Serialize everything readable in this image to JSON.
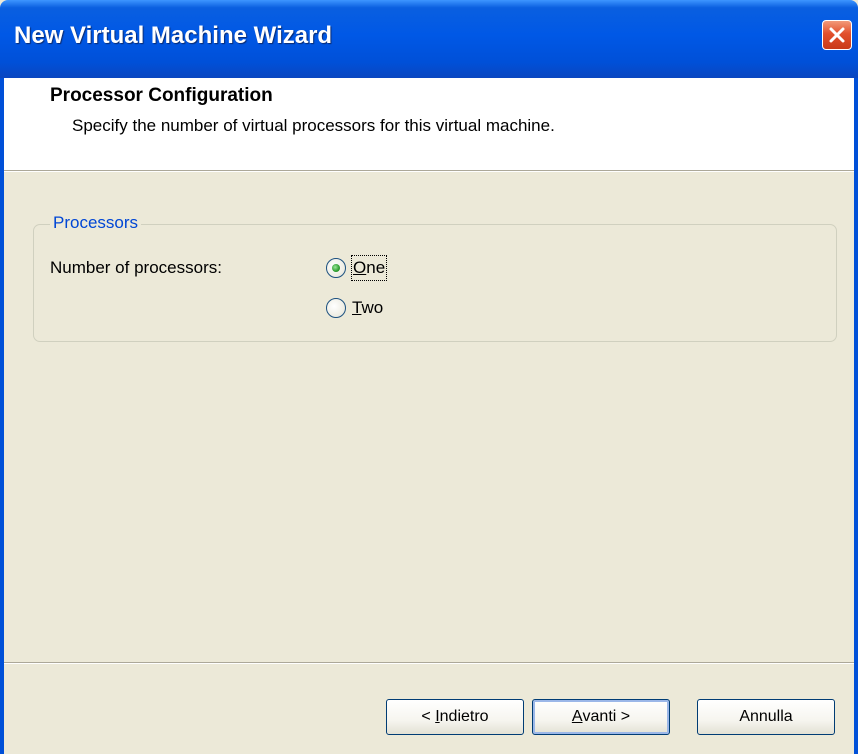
{
  "window": {
    "title": "New Virtual Machine Wizard",
    "close_symbol": "✕"
  },
  "header": {
    "title": "Processor Configuration",
    "description": "Specify the number of virtual processors for this virtual machine."
  },
  "processors": {
    "group_label": "Processors",
    "field_label": "Number of processors:",
    "options": [
      {
        "prefix": "",
        "mnemonic": "O",
        "suffix": "ne",
        "selected": true
      },
      {
        "prefix": "",
        "mnemonic": "T",
        "suffix": "wo",
        "selected": false
      }
    ]
  },
  "buttons": {
    "back": {
      "prefix": "< ",
      "mnemonic": "I",
      "suffix": "ndietro"
    },
    "next": {
      "prefix": "",
      "mnemonic": "A",
      "suffix": "vanti >"
    },
    "cancel": {
      "label": "Annulla"
    }
  },
  "colors": {
    "titlebar": "#0050d8",
    "dialog_bg": "#ece9d8",
    "group_label": "#0046d5",
    "close_button": "#e2502c",
    "radio_selected": "#2f9e2f"
  }
}
